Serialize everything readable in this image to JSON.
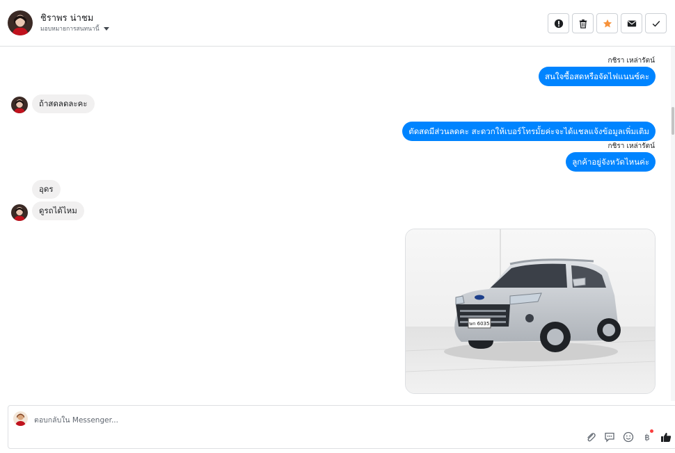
{
  "header": {
    "name": "ชิราพร น่าชม",
    "assign_label": "มอบหมายการสนทนานี้",
    "actions": [
      "mark-spam",
      "delete",
      "star",
      "mark-unread",
      "done"
    ]
  },
  "messages": [
    {
      "sender": "กชิรา เหล่ารัตน์",
      "text": "สนใจซื้อสดหรือจัดไฟแนนซ์คะ"
    },
    {
      "text": "ถ้าสดลดละคะ"
    },
    {
      "text": "ตัดสดมีส่วนลดคะ สะดวกให้เบอร์โทรมั้ยค่ะจะได้แชลแจ้งข้อมูลเพิ่มเติม"
    },
    {
      "sender": "กชิรา เหล่ารัตน์",
      "text": "ลูกค้าอยู่จังหวัดไหนค่ะ"
    },
    {
      "text": "อุดร"
    },
    {
      "text": "ดูรถได้ไหม"
    }
  ],
  "photo": {
    "plate": "ษก 6035"
  },
  "composer": {
    "placeholder": "ตอบกลับใน Messenger...",
    "icons": [
      "attach-icon",
      "saved-reply-icon",
      "emoji-icon",
      "baht-icon",
      "like-icon"
    ]
  },
  "colors": {
    "outgoing": "#0084ff",
    "incoming": "#f1f0f0",
    "star": "#f7923a"
  }
}
